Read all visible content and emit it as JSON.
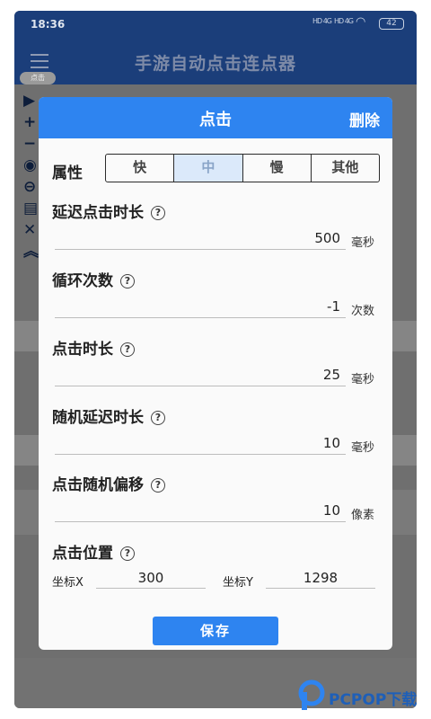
{
  "status_bar": {
    "time": "18:36",
    "signal1": "HD 4G",
    "signal2": "HD 4G",
    "battery": "42"
  },
  "app_bar": {
    "title": "手游自动点击连点器"
  },
  "background": {
    "tag": "点击"
  },
  "dialog": {
    "title": "点击",
    "delete_label": "删除",
    "attribute": {
      "label": "属性",
      "options": [
        "快",
        "中",
        "慢",
        "其他"
      ],
      "selected": "中"
    },
    "fields": [
      {
        "label": "延迟点击时长",
        "value": "500",
        "unit": "毫秒"
      },
      {
        "label": "循环次数",
        "value": "-1",
        "unit": "次数"
      },
      {
        "label": "点击时长",
        "value": "25",
        "unit": "毫秒"
      },
      {
        "label": "随机延迟时长",
        "value": "10",
        "unit": "毫秒"
      },
      {
        "label": "点击随机偏移",
        "value": "10",
        "unit": "像素"
      }
    ],
    "position": {
      "label": "点击位置",
      "x_label": "坐标X",
      "x_value": "300",
      "y_label": "坐标Y",
      "y_value": "1298"
    },
    "help_glyph": "?",
    "save_label": "保存"
  },
  "watermark": {
    "text": "PCPOP下载"
  },
  "colors": {
    "accent": "#2e84f0",
    "appbar": "#1b3e7a",
    "selected_segment": "#dbe9fa"
  }
}
